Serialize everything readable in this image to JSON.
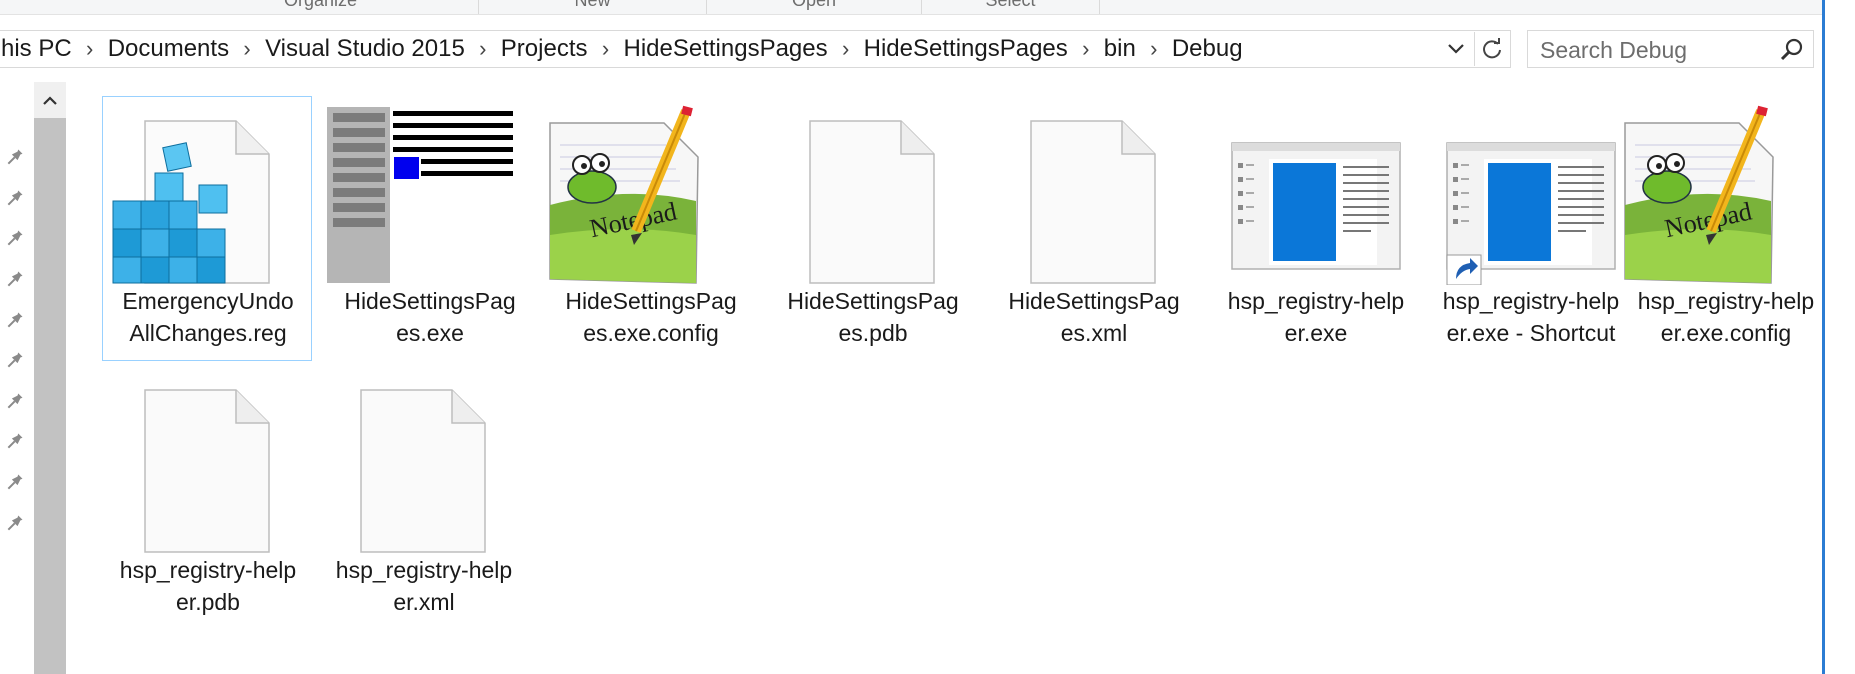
{
  "ribbon": {
    "groups": [
      "Organize",
      "New",
      "Open",
      "Select"
    ]
  },
  "address": {
    "crumbs": [
      "his PC",
      "Documents",
      "Visual Studio 2015",
      "Projects",
      "HideSettingsPages",
      "HideSettingsPages",
      "bin",
      "Debug"
    ]
  },
  "search": {
    "placeholder": "Search Debug"
  },
  "icons": {
    "dropdown": "chevron-down-icon",
    "refresh": "refresh-icon",
    "search": "search-icon",
    "pin": "pin-icon",
    "scroll_up": "chevron-up-icon"
  },
  "colors": {
    "accent": "#2b7cd3",
    "selection_border": "#99d1ff",
    "registry_blue": "#1e9ad6",
    "notepad_green": "#7ab33a",
    "app_blue": "#0b77d8"
  },
  "files": [
    {
      "line1": "EmergencyUndo",
      "line2": "AllChanges.reg",
      "icon": "registry-icon"
    },
    {
      "line1": "HideSettingsPag",
      "line2": "es.exe",
      "icon": "exe-app-icon"
    },
    {
      "line1": "HideSettingsPag",
      "line2": "es.exe.config",
      "icon": "notepadpp-icon"
    },
    {
      "line1": "HideSettingsPag",
      "line2": "es.pdb",
      "icon": "blank-file-icon"
    },
    {
      "line1": "HideSettingsPag",
      "line2": "es.xml",
      "icon": "blank-file-icon"
    },
    {
      "line1": "hsp_registry-help",
      "line2": "er.exe",
      "icon": "window-app-icon"
    },
    {
      "line1": "hsp_registry-help",
      "line2": "er.exe - Shortcut",
      "icon": "window-app-shortcut-icon"
    },
    {
      "line1": "hsp_registry-help",
      "line2": "er.exe.config",
      "icon": "notepadpp-icon"
    },
    {
      "line1": "hsp_registry-help",
      "line2": "er.pdb",
      "icon": "blank-file-icon"
    },
    {
      "line1": "hsp_registry-help",
      "line2": "er.xml",
      "icon": "blank-file-icon"
    }
  ]
}
